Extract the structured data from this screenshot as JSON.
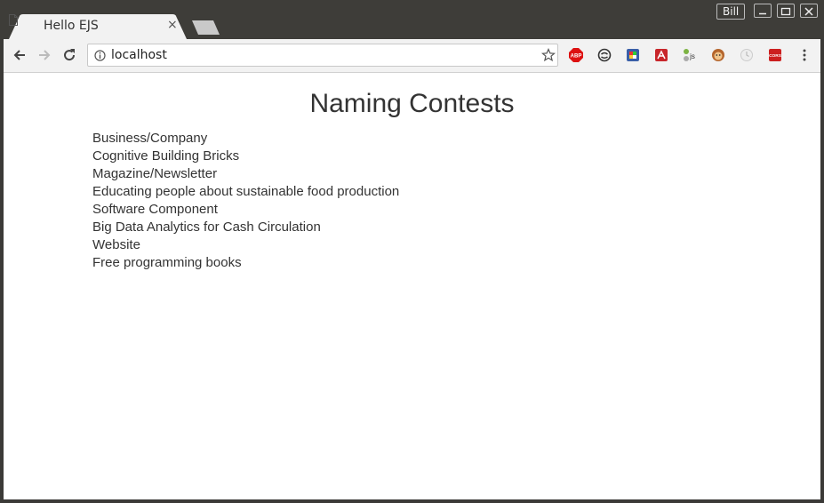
{
  "browser": {
    "tab": {
      "title": "Hello EJS",
      "close": "×"
    },
    "profile": "Bill",
    "omnibox": {
      "url": "localhost"
    },
    "extensions": [
      "adblock-plus",
      "sync",
      "color-picker",
      "ext-red",
      "node-js",
      "monkey",
      "clock",
      "cors"
    ]
  },
  "page": {
    "heading": "Naming Contests",
    "contests": [
      "Business/Company",
      "Cognitive Building Bricks",
      "Magazine/Newsletter",
      "Educating people about sustainable food production",
      "Software Component",
      "Big Data Analytics for Cash Circulation",
      "Website",
      "Free programming books"
    ]
  }
}
